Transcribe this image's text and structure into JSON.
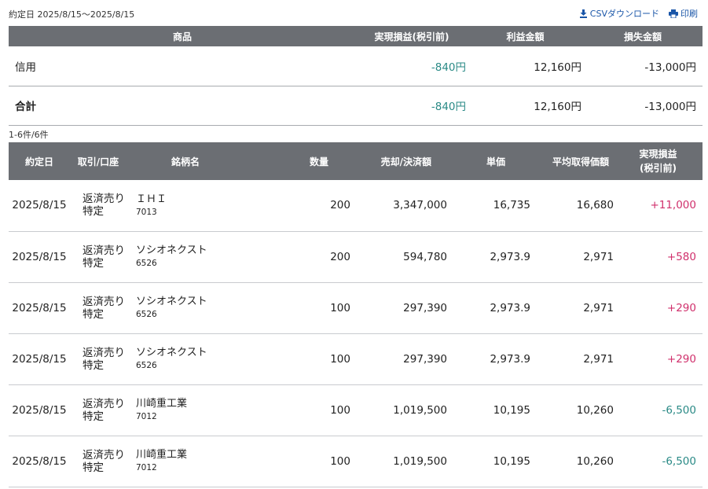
{
  "header": {
    "period": "約定日 2025/8/15〜2025/8/15",
    "csv_label": "CSVダウンロード",
    "print_label": "印刷"
  },
  "summary": {
    "columns": [
      "商品",
      "実現損益(税引前)",
      "利益金額",
      "損失金額"
    ],
    "rows": [
      {
        "product": "信用",
        "pl": "-840円",
        "profit": "12,160円",
        "loss": "-13,000円"
      }
    ],
    "total": {
      "product": "合計",
      "pl": "-840円",
      "profit": "12,160円",
      "loss": "-13,000円"
    }
  },
  "count_text": "1-6件/6件",
  "detail": {
    "columns": {
      "date": "約定日",
      "trade": "取引/口座",
      "stock": "銘柄名",
      "qty": "数量",
      "amount": "売却/決済額",
      "price": "単価",
      "avg": "平均取得価額",
      "pl_line1": "実現損益",
      "pl_line2": "(税引前)"
    },
    "rows": [
      {
        "date": "2025/8/15",
        "trade": "返済売り",
        "account": "特定",
        "name": "ＩＨＩ",
        "code": "7013",
        "qty": "200",
        "amount": "3,347,000",
        "price": "16,735",
        "avg": "16,680",
        "pl": "+11,000"
      },
      {
        "date": "2025/8/15",
        "trade": "返済売り",
        "account": "特定",
        "name": "ソシオネクスト",
        "code": "6526",
        "qty": "200",
        "amount": "594,780",
        "price": "2,973.9",
        "avg": "2,971",
        "pl": "+580"
      },
      {
        "date": "2025/8/15",
        "trade": "返済売り",
        "account": "特定",
        "name": "ソシオネクスト",
        "code": "6526",
        "qty": "100",
        "amount": "297,390",
        "price": "2,973.9",
        "avg": "2,971",
        "pl": "+290"
      },
      {
        "date": "2025/8/15",
        "trade": "返済売り",
        "account": "特定",
        "name": "ソシオネクスト",
        "code": "6526",
        "qty": "100",
        "amount": "297,390",
        "price": "2,973.9",
        "avg": "2,971",
        "pl": "+290"
      },
      {
        "date": "2025/8/15",
        "trade": "返済売り",
        "account": "特定",
        "name": "川崎重工業",
        "code": "7012",
        "qty": "100",
        "amount": "1,019,500",
        "price": "10,195",
        "avg": "10,260",
        "pl": "-6,500"
      },
      {
        "date": "2025/8/15",
        "trade": "返済売り",
        "account": "特定",
        "name": "川崎重工業",
        "code": "7012",
        "qty": "100",
        "amount": "1,019,500",
        "price": "10,195",
        "avg": "10,260",
        "pl": "-6,500"
      }
    ]
  },
  "colors": {
    "header_bg": "#6b6e73",
    "link": "#1a56a8",
    "negative": "#2a8a86",
    "positive": "#d0306c"
  }
}
